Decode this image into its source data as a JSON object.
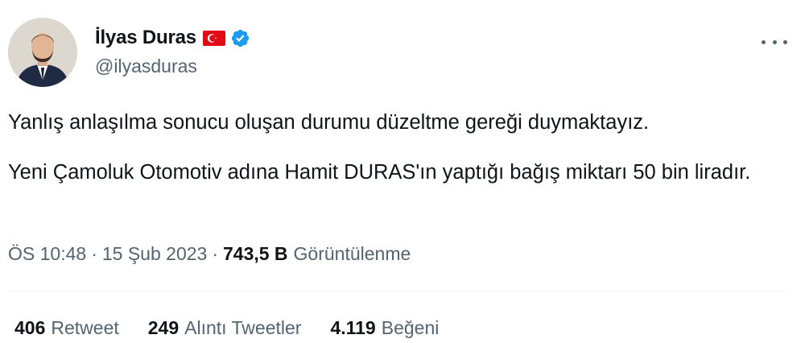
{
  "author": {
    "display_name": "İlyas Duras",
    "handle": "@ilyasduras",
    "flag_icon": "turkey-flag-icon",
    "verified_icon": "verified-badge-icon"
  },
  "tweet": {
    "paragraphs": [
      "Yanlış anlaşılma sonucu oluşan durumu düzeltme gereği duymaktayız.",
      "Yeni Çamoluk Otomotiv adına Hamit DURAS'ın yaptığı bağış miktarı 50 bin liradır."
    ]
  },
  "meta": {
    "time": "ÖS 10:48",
    "date": "15 Şub 2023",
    "separator": "·",
    "views_count": "743,5 B",
    "views_label": "Görüntülenme"
  },
  "stats": [
    {
      "count": "406",
      "label": "Retweet"
    },
    {
      "count": "249",
      "label": "Alıntı Tweetler"
    },
    {
      "count": "4.119",
      "label": "Beğeni"
    }
  ],
  "colors": {
    "text": "#0f1419",
    "secondary": "#536471",
    "verified": "#1d9bf0",
    "flag_red": "#e30a17"
  }
}
